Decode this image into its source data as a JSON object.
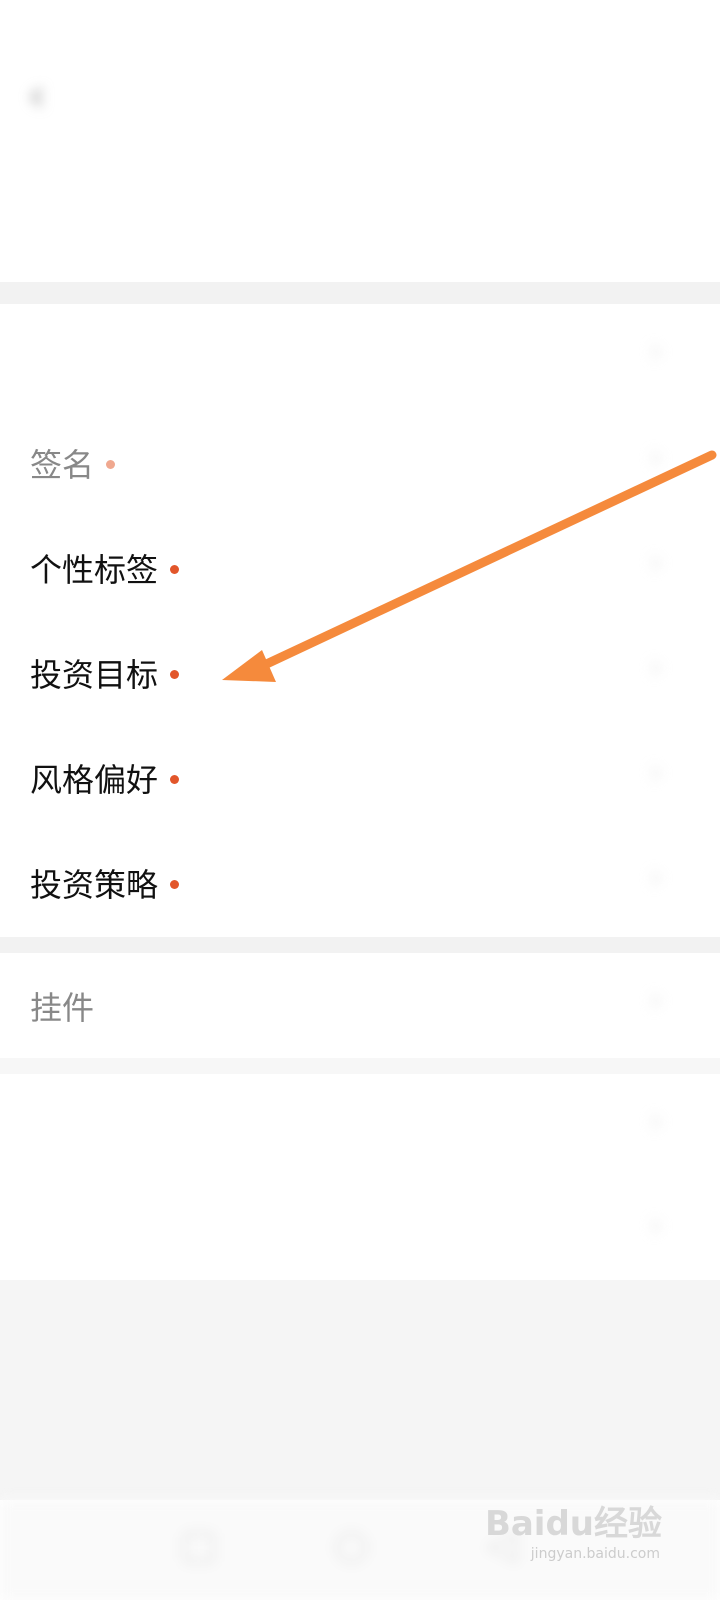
{
  "status": {
    "time": "",
    "icons": ""
  },
  "header": {
    "back_icon": "chevron-left-icon",
    "title": ""
  },
  "profile": {
    "subtitle": "",
    "description": ""
  },
  "rows": [
    {
      "label": "",
      "value": ""
    },
    {
      "label": "签名",
      "value": ""
    },
    {
      "label": "个性标签",
      "value": ""
    },
    {
      "label": "投资目标",
      "value": ""
    },
    {
      "label": "风格偏好",
      "value": ""
    },
    {
      "label": "投资策略",
      "value": ""
    },
    {
      "label": "挂件",
      "value": ""
    },
    {
      "label": "",
      "value": ""
    },
    {
      "label": "",
      "value": ""
    }
  ],
  "footer": {
    "link": ""
  },
  "watermark": {
    "brand": "Baidu经验",
    "url": "jingyan.baidu.com"
  },
  "colors": {
    "required_dot": "#e2562a",
    "annotation_arrow": "#f58a3c"
  }
}
